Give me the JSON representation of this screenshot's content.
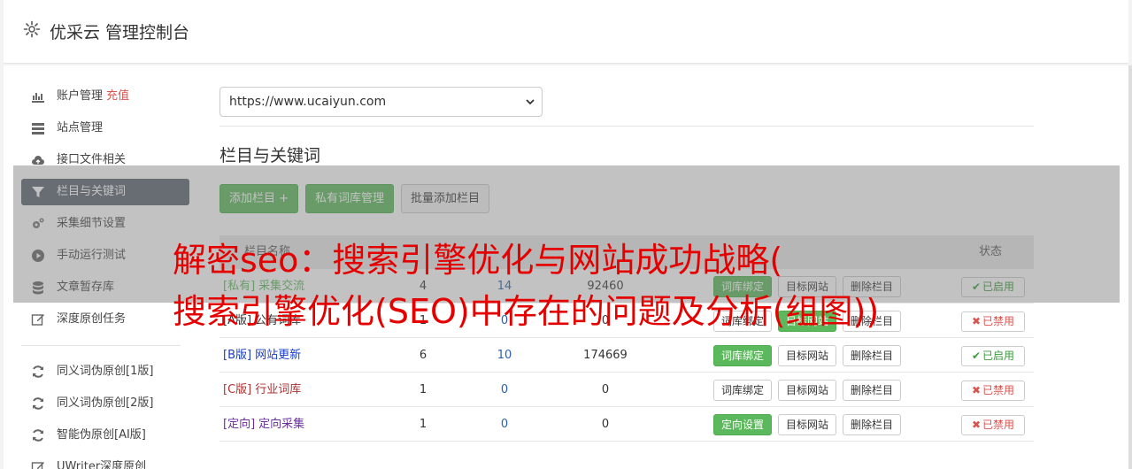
{
  "header": {
    "title": "优采云 管理控制台"
  },
  "sidebar": {
    "items": [
      {
        "label": "账户管理",
        "extra": "充值",
        "icon": "bar-chart-icon"
      },
      {
        "label": "站点管理",
        "icon": "server-icon"
      },
      {
        "label": "接口文件相关",
        "icon": "cloud-upload-icon"
      },
      {
        "label": "栏目与关键词",
        "icon": "filter-icon",
        "active": true
      },
      {
        "label": "采集细节设置",
        "icon": "cogs-icon"
      },
      {
        "label": "手动运行测试",
        "icon": "play-circle-icon"
      },
      {
        "label": "文章暂存库",
        "icon": "database-icon"
      },
      {
        "label": "深度原创任务",
        "icon": "edit-icon"
      }
    ],
    "items2": [
      {
        "label": "同义词伪原创[1版]",
        "icon": "refresh-icon"
      },
      {
        "label": "同义词伪原创[2版]",
        "icon": "refresh-icon"
      },
      {
        "label": "智能伪原创[AI版]",
        "icon": "refresh-icon"
      },
      {
        "label": "UWriter深度原创",
        "icon": "edit-icon"
      }
    ]
  },
  "main": {
    "site_select": "https://www.ucaiyun.com",
    "section_title": "栏目与关键词",
    "buttons": {
      "add_column": "添加栏目 +",
      "private_lib": "私有词库管理",
      "batch_add": "批量添加栏目"
    },
    "table": {
      "headers": {
        "name": "栏目名称",
        "status": "状态"
      },
      "rows": [
        {
          "tag": "[私有]",
          "name": "采集交流",
          "n1": "4",
          "n2": "14",
          "n3": "92460",
          "bind": "词库绑定",
          "target": "目标网站",
          "del": "删除栏目",
          "status": "已启用",
          "status_mark": "✔",
          "enabled": true,
          "bind_green": true,
          "tag_color": "#5cb85c"
        },
        {
          "tag": "[A版]",
          "name": "公有词库",
          "n1": "1",
          "n2": "0",
          "n3": "0",
          "bind": "词库绑定",
          "target": "目标网站",
          "del": "删除栏目",
          "status": "已禁用",
          "status_mark": "✖",
          "enabled": false,
          "bind_green": false,
          "target_green": true,
          "tag_color": "#333333"
        },
        {
          "tag": "[B版]",
          "name": "网站更新",
          "n1": "6",
          "n2": "10",
          "n3": "174669",
          "bind": "词库绑定",
          "target": "目标网站",
          "del": "删除栏目",
          "status": "已启用",
          "status_mark": "✔",
          "enabled": true,
          "bind_green": true,
          "tag_color": "#1a3cc4"
        },
        {
          "tag": "[C版]",
          "name": "行业词库",
          "n1": "1",
          "n2": "0",
          "n3": "0",
          "bind": "词库绑定",
          "target": "目标网站",
          "del": "删除栏目",
          "status": "已禁用",
          "status_mark": "✖",
          "enabled": false,
          "bind_green": false,
          "tag_color": "#b03030"
        },
        {
          "tag": "[定向]",
          "name": "定向采集",
          "n1": "1",
          "n2": "0",
          "n3": "0",
          "bind": "定向设置",
          "target": "目标网站",
          "del": "删除栏目",
          "status": "已禁用",
          "status_mark": "✖",
          "enabled": false,
          "bind_green": true,
          "tag_color": "#6a2fa0"
        }
      ]
    }
  },
  "overlay": {
    "line1": "解密seo：搜索引擎优化与网站成功战略(",
    "line2": "搜索引擎优化(SEO)中存在的问题及分析(组图))"
  },
  "colors": {
    "green": "#5cb85c",
    "active_nav": "#5b6472",
    "overlay_red": "#e50000",
    "disabled_red": "#d9534f"
  }
}
